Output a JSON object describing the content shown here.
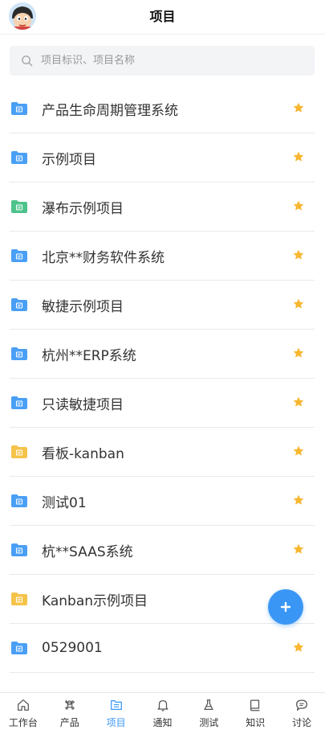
{
  "header": {
    "title": "项目"
  },
  "search": {
    "placeholder": "项目标识、项目名称"
  },
  "projects": [
    {
      "name": "产品生命周期管理系统",
      "icon": "folder-blue-icon",
      "starred": true
    },
    {
      "name": "示例项目",
      "icon": "folder-blue-icon",
      "starred": true
    },
    {
      "name": "瀑布示例项目",
      "icon": "folder-green-icon",
      "starred": true
    },
    {
      "name": "北京**财务软件系统",
      "icon": "folder-blue-icon",
      "starred": true
    },
    {
      "name": "敏捷示例项目",
      "icon": "folder-blue-icon",
      "starred": true
    },
    {
      "name": "杭州**ERP系统",
      "icon": "folder-blue-icon",
      "starred": true
    },
    {
      "name": "只读敏捷项目",
      "icon": "folder-blue-icon",
      "starred": true
    },
    {
      "name": "看板-kanban",
      "icon": "folder-yellow-icon",
      "starred": true
    },
    {
      "name": "测试01",
      "icon": "folder-blue-icon",
      "starred": true
    },
    {
      "name": "杭**SAAS系统",
      "icon": "folder-blue-icon",
      "starred": true
    },
    {
      "name": "Kanban示例项目",
      "icon": "folder-yellow-icon",
      "starred": true
    },
    {
      "name": "0529001",
      "icon": "folder-blue-icon",
      "starred": true
    }
  ],
  "tabs": [
    {
      "label": "工作台",
      "icon": "home-icon",
      "active": false
    },
    {
      "label": "产品",
      "icon": "command-icon",
      "active": false
    },
    {
      "label": "项目",
      "icon": "project-icon",
      "active": true
    },
    {
      "label": "通知",
      "icon": "bell-icon",
      "active": false
    },
    {
      "label": "测试",
      "icon": "flask-icon",
      "active": false
    },
    {
      "label": "知识",
      "icon": "book-icon",
      "active": false
    },
    {
      "label": "讨论",
      "icon": "chat-icon",
      "active": false
    }
  ],
  "colors": {
    "accent": "#3a96f5",
    "star": "#f7b731",
    "folder_blue": "#4a9ff5",
    "folder_green": "#4cc38a",
    "folder_yellow": "#f5c34a"
  }
}
